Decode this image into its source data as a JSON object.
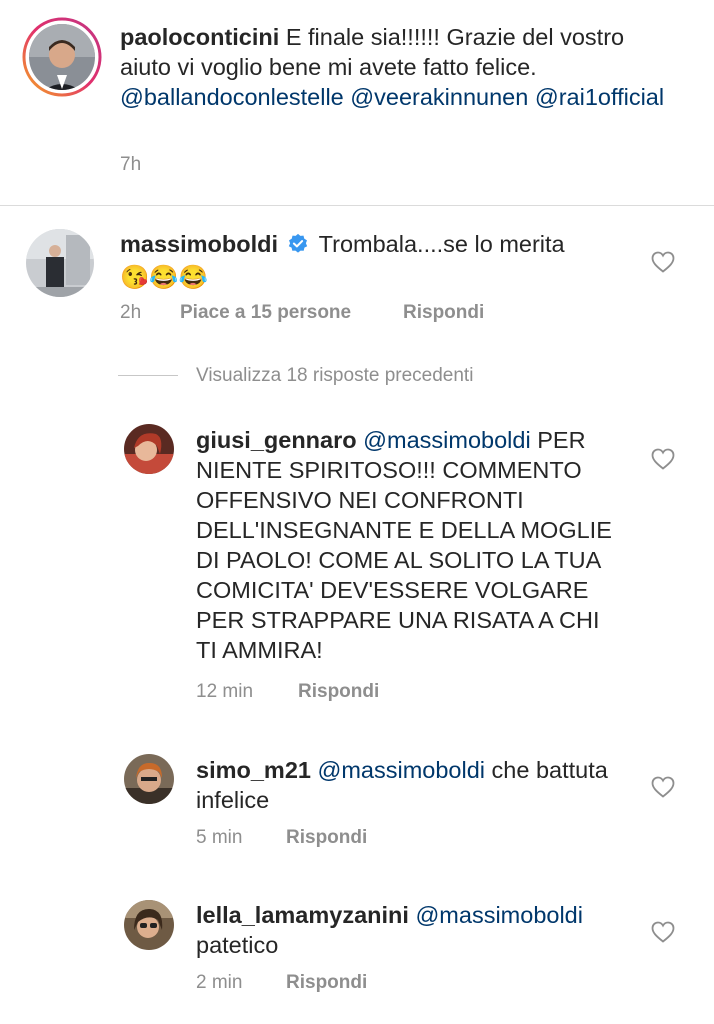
{
  "caption": {
    "username": "paoloconticini",
    "text": "E finale sia!!!!!! Grazie del vostro aiuto vi voglio bene mi avete fatto felice.",
    "mentions": [
      "@ballandoconlestelle",
      "@veerakinnunen",
      "@rai1official"
    ],
    "time": "7h"
  },
  "comment": {
    "username": "massimoboldi",
    "verified": true,
    "text": "Trombala....se lo merita",
    "emoji": "😘😂😂",
    "time": "2h",
    "likes": "Piace a 15 persone",
    "reply": "Rispondi"
  },
  "view_replies": "Visualizza 18 risposte precedenti",
  "replies": [
    {
      "username": "giusi_gennaro",
      "mention": "@massimoboldi",
      "text": "PER NIENTE SPIRITOSO!!! COMMENTO OFFENSIVO  NEI CONFRONTI DELL'INSEGNANTE E DELLA MOGLIE DI PAOLO! COME AL SOLITO LA TUA COMICITA' DEV'ESSERE VOLGARE PER STRAPPARE UNA RISATA A CHI TI AMMIRA!",
      "time": "12 min",
      "reply": "Rispondi"
    },
    {
      "username": "simo_m21",
      "mention": "@massimoboldi",
      "text": "che battuta infelice",
      "time": "5 min",
      "reply": "Rispondi"
    },
    {
      "username": "lella_lamamyzanini",
      "mention": "@massimoboldi",
      "text": "patetico",
      "time": "2 min",
      "reply": "Rispondi"
    }
  ],
  "colors": {
    "text": "#262626",
    "mention": "#00376b",
    "meta": "#8e8e8e",
    "verified": "#3897f0",
    "story_ring": "#e1306c"
  }
}
